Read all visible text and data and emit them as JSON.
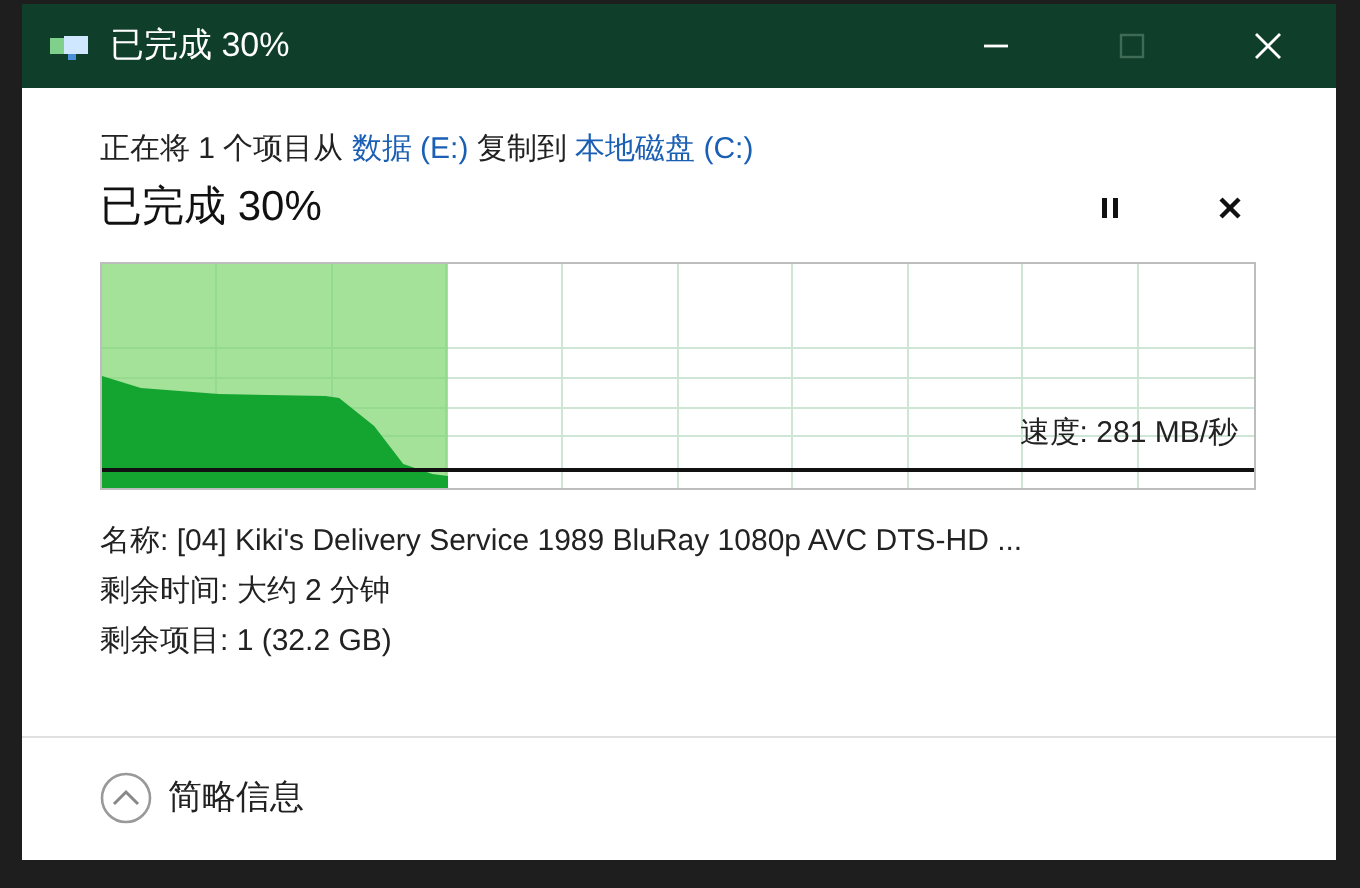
{
  "window": {
    "title": "已完成 30%",
    "controls": [
      {
        "kind": "minimize",
        "disabled": false
      },
      {
        "kind": "maximize",
        "disabled": true
      },
      {
        "kind": "close",
        "disabled": false
      }
    ]
  },
  "summary": [
    {
      "kind": "text",
      "text": "正在将 1 个项目从"
    },
    {
      "kind": "link",
      "text": "数据 (E:)"
    },
    {
      "kind": "text",
      "text": "复制到"
    },
    {
      "kind": "link",
      "text": "本地磁盘 (C:)"
    }
  ],
  "heading": "已完成 30%",
  "actions": [
    {
      "kind": "pause"
    },
    {
      "kind": "cancel"
    }
  ],
  "progress": {
    "level": 0.3,
    "speed": "速度: 281 MB/秒"
  },
  "details": [
    "名称: [04] Kiki's Delivery Service 1989 BluRay 1080p AVC DTS-HD ...",
    "剩余时间: 大约 2 分钟",
    "剩余项目: 1 (32.2 GB)"
  ],
  "footer": {
    "label": "简略信息",
    "expanded": true
  }
}
